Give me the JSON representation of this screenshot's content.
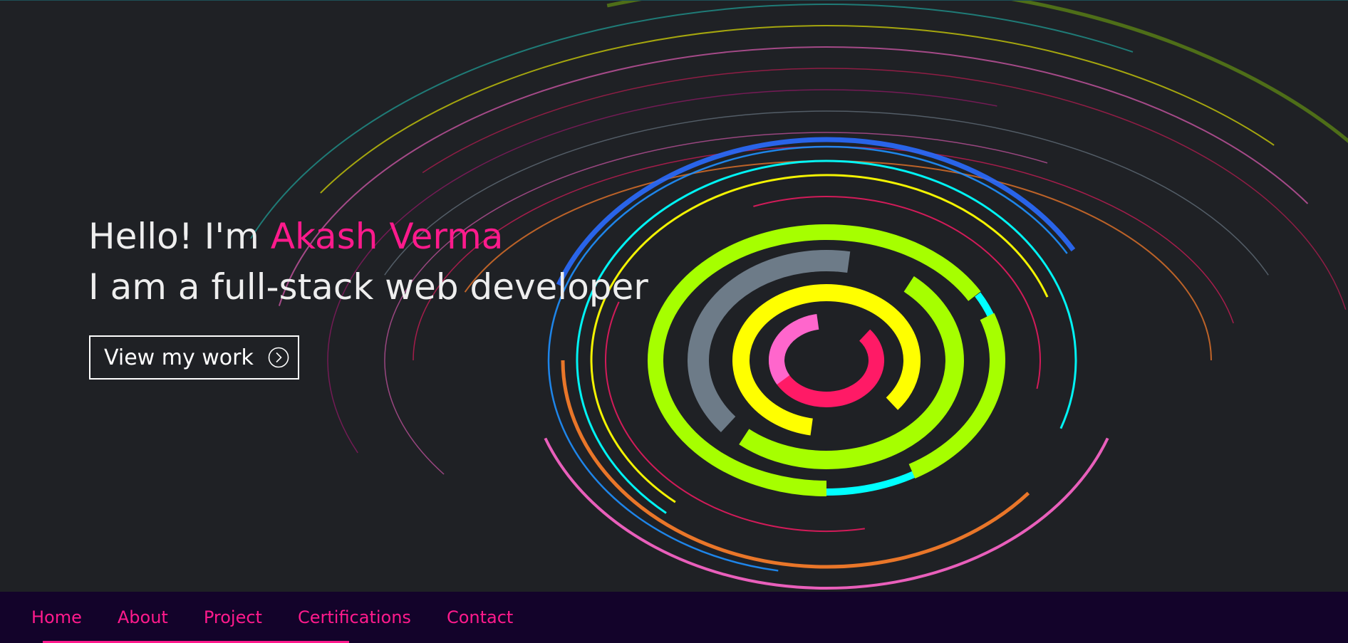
{
  "hero": {
    "greeting_prefix": "Hello! I'm",
    "name": "Akash Verma",
    "tagline": "I am a full-stack web developer",
    "cta_label": "View my work",
    "cta_icon": "chevron-right-circle-icon",
    "colors": {
      "background": "#1f2125",
      "accent": "#ff1a8c",
      "text": "#eeeeee"
    }
  },
  "nav": {
    "items": [
      {
        "label": "Home"
      },
      {
        "label": "About"
      },
      {
        "label": "Project"
      },
      {
        "label": "Certifications"
      },
      {
        "label": "Contact"
      }
    ],
    "background": "#13032a",
    "link_color": "#ff1a8c"
  },
  "decoration": {
    "ring_palette": [
      "#a6ff00",
      "#ffff00",
      "#00ffff",
      "#ff1a66",
      "#1e90ff",
      "#ff7f2a",
      "#ff66cc",
      "#8899aa",
      "#2a6cff",
      "#c71585",
      "#1fa39a"
    ]
  }
}
